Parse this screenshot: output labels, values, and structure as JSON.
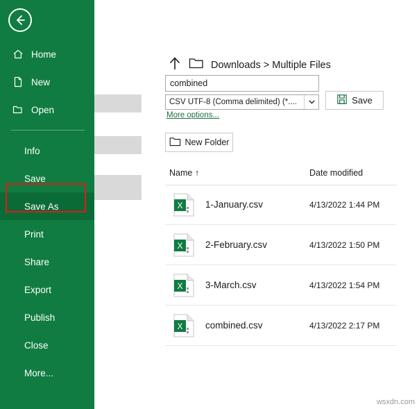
{
  "backstage": {
    "back_button_icon": "back-arrow-icon",
    "items": [
      {
        "label": "Home",
        "icon": "home-icon",
        "selected": false
      },
      {
        "label": "New",
        "icon": "new-document-icon",
        "selected": false
      },
      {
        "label": "Open",
        "icon": "open-folder-icon",
        "selected": false
      },
      {
        "label": "Info",
        "icon": "",
        "selected": false
      },
      {
        "label": "Save",
        "icon": "",
        "selected": false
      },
      {
        "label": "Save As",
        "icon": "",
        "selected": true
      },
      {
        "label": "Print",
        "icon": "",
        "selected": false
      },
      {
        "label": "Share",
        "icon": "",
        "selected": false
      },
      {
        "label": "Export",
        "icon": "",
        "selected": false
      },
      {
        "label": "Publish",
        "icon": "",
        "selected": false
      },
      {
        "label": "Close",
        "icon": "",
        "selected": false
      },
      {
        "label": "More...",
        "icon": "",
        "selected": false
      }
    ],
    "highlight_color": "#e01b1b",
    "background_color": "#107c41"
  },
  "saveas": {
    "breadcrumb": "Downloads > Multiple Files",
    "up_icon": "up-arrow-icon",
    "folder_icon": "folder-icon",
    "filename_value": "combined",
    "filename_placeholder": "File name",
    "filetype_value": "CSV UTF-8 (Comma delimited) (*....",
    "filetype_arrow_icon": "chevron-down-icon",
    "more_options_label": "More options...",
    "save_label": "Save",
    "save_icon": "save-icon",
    "new_folder_label": "New Folder",
    "new_folder_icon": "new-folder-icon",
    "columns": {
      "name": "Name",
      "name_sort_icon": "sort-ascending-icon",
      "date": "Date modified"
    },
    "files": [
      {
        "name": "1-January.csv",
        "date": "4/13/2022 1:44 PM",
        "icon": "excel-csv-file-icon"
      },
      {
        "name": "2-February.csv",
        "date": "4/13/2022 1:50 PM",
        "icon": "excel-csv-file-icon"
      },
      {
        "name": "3-March.csv",
        "date": "4/13/2022 1:54 PM",
        "icon": "excel-csv-file-icon"
      },
      {
        "name": "combined.csv",
        "date": "4/13/2022 2:17 PM",
        "icon": "excel-csv-file-icon"
      }
    ]
  },
  "watermark": "wsxdn.com"
}
